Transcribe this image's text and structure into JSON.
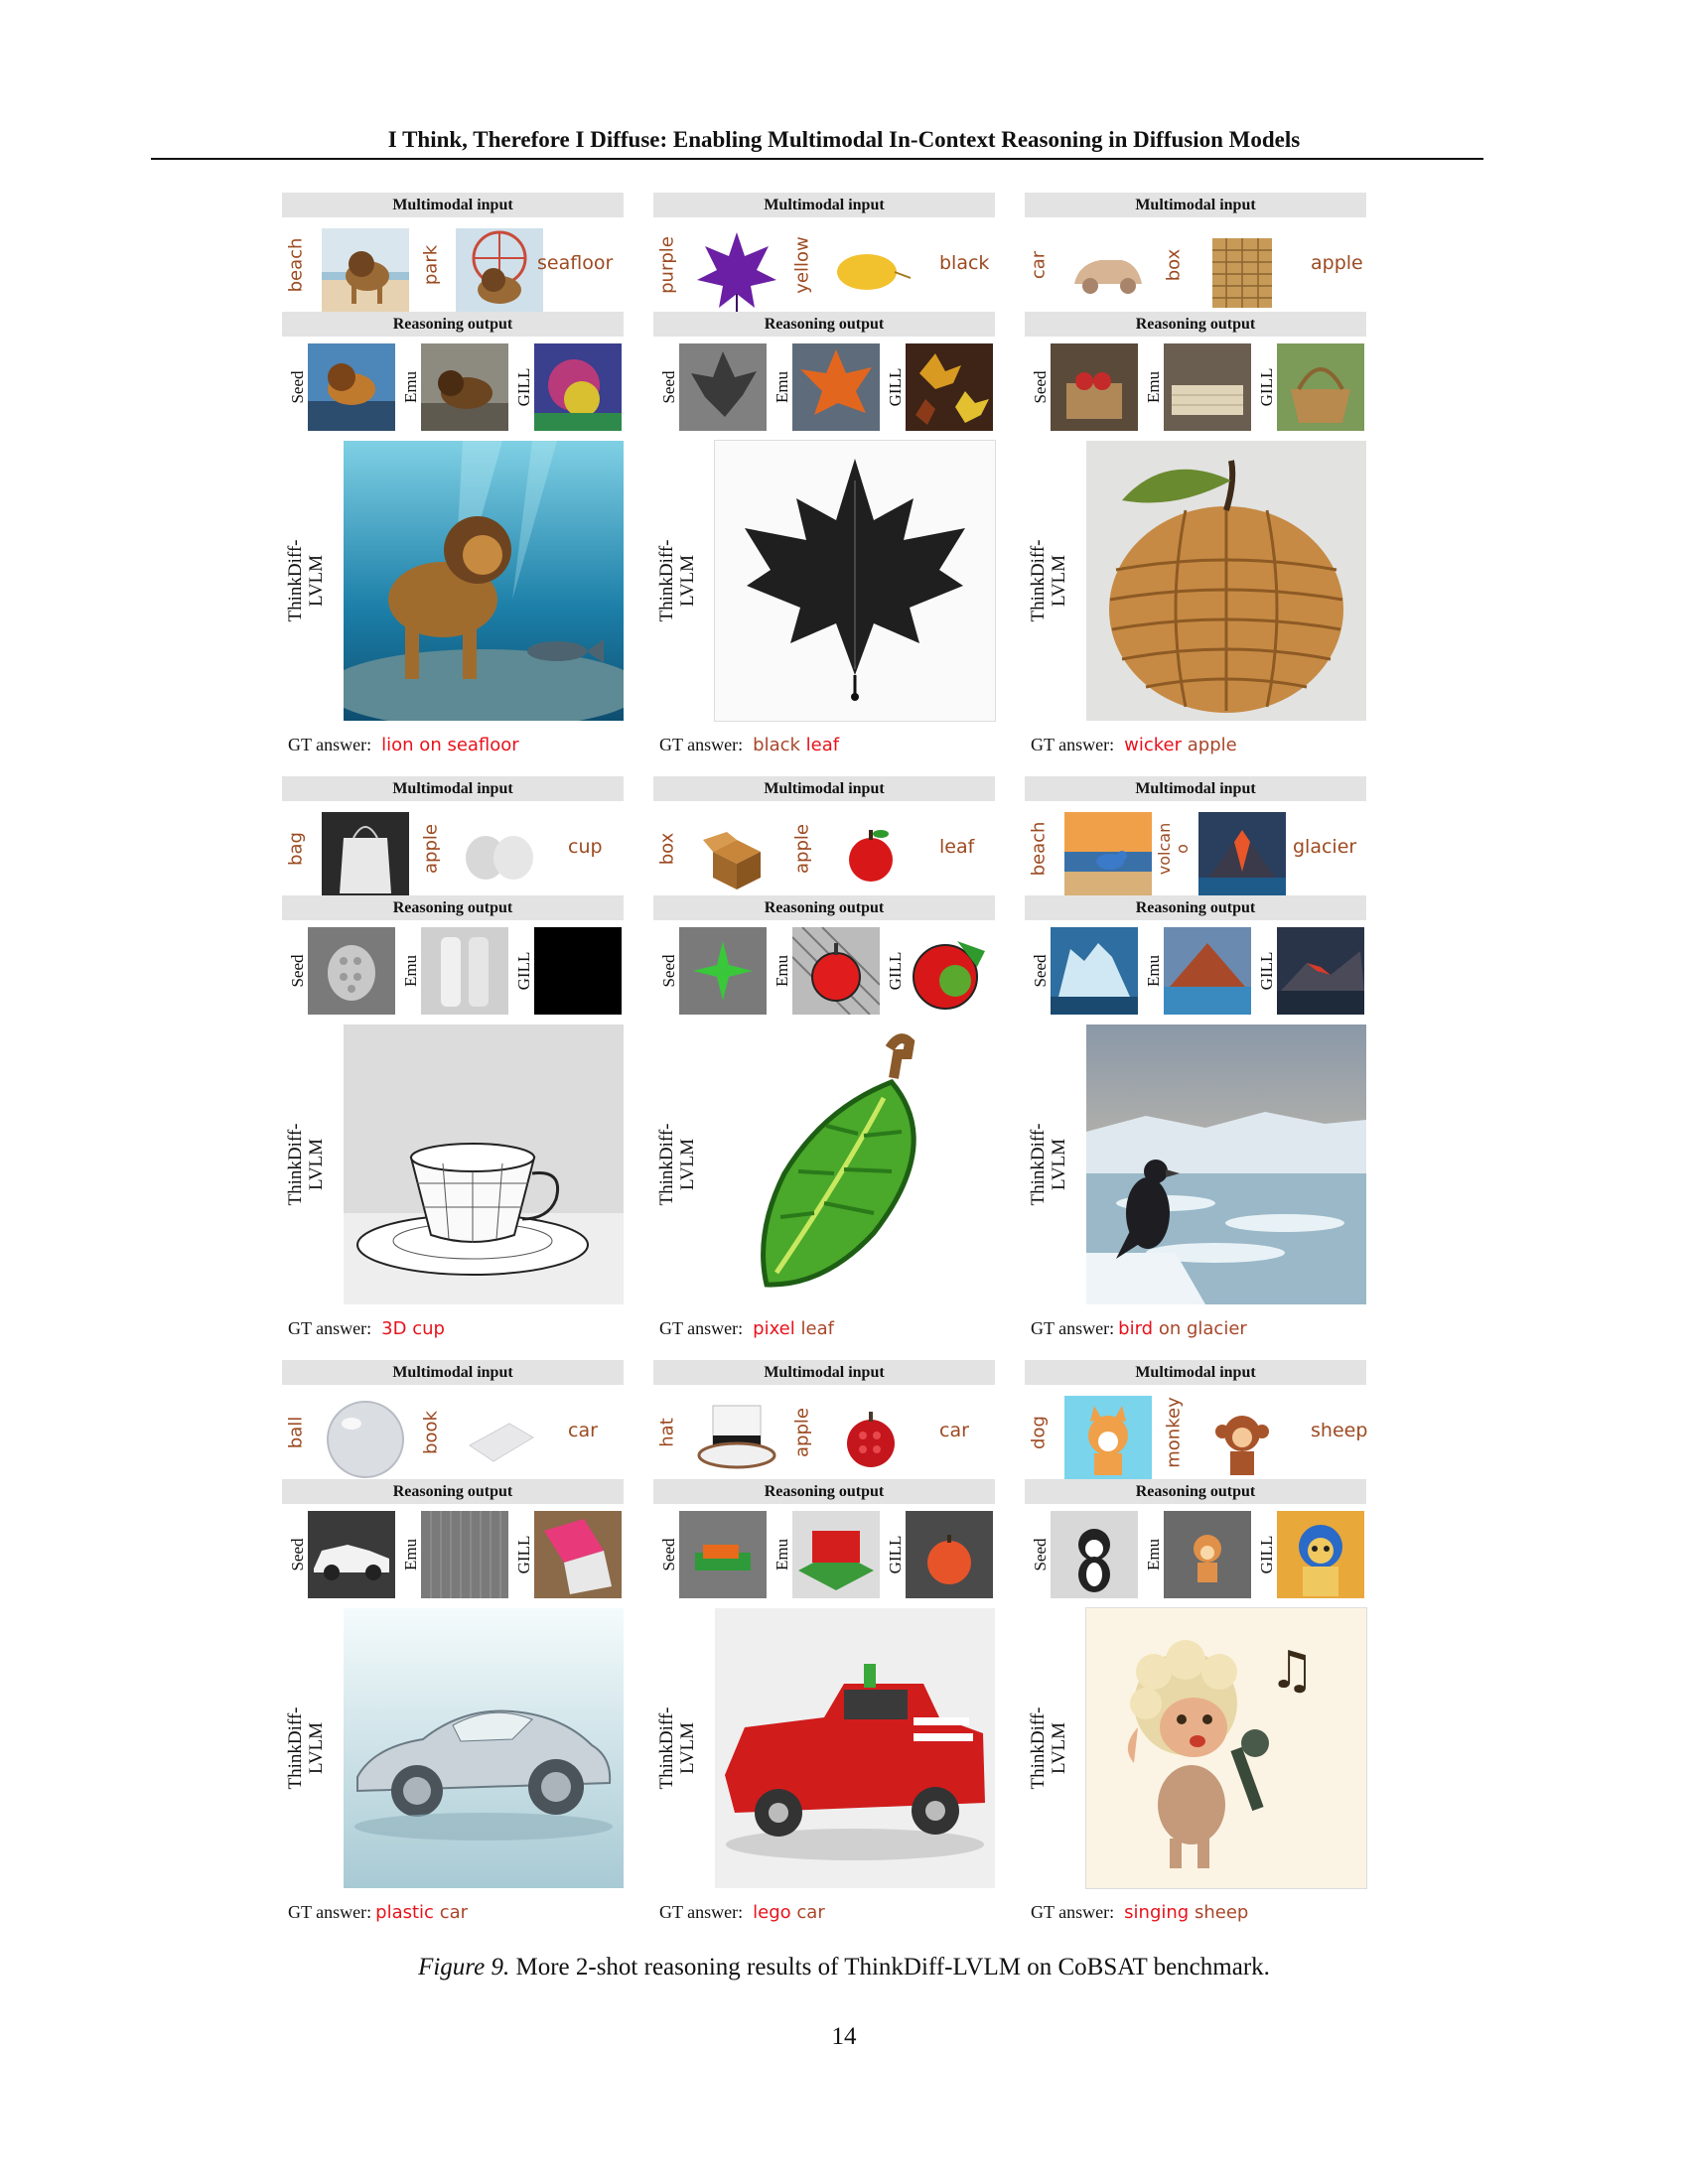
{
  "paper_title": "I Think, Therefore I Diffuse: Enabling Multimodal In-Context Reasoning in Diffusion Models",
  "section_labels": {
    "input": "Multimodal input",
    "output": "Reasoning output"
  },
  "models": [
    "Seed",
    "Emu",
    "GILL"
  ],
  "main_model_line1": "ThinkDiff-",
  "main_model_line2": "LVLM",
  "gt_prefix": "GT answer:",
  "panels": [
    {
      "label_a": "beach",
      "label_b": "park",
      "label_c": "seafloor",
      "ans_key": "lion on seafloor",
      "ans_rest": ""
    },
    {
      "label_a": "purple",
      "label_b": "yellow",
      "label_c": "black",
      "ans_key": "black",
      "ans_rest": "leaf",
      "key_color": "#a8462a",
      "rest_color": "#e8121b"
    },
    {
      "label_a": "car",
      "label_b": "box",
      "label_c": "apple",
      "ans_key": "wicker",
      "ans_rest": "apple"
    },
    {
      "label_a": "bag",
      "label_b": "apple",
      "label_c": "cup",
      "ans_key": "3D cup",
      "ans_rest": ""
    },
    {
      "label_a": "box",
      "label_b": "apple",
      "label_c": "leaf",
      "ans_key": "pixel",
      "ans_rest": "leaf"
    },
    {
      "label_a": "beach",
      "label_b": "volcan\no",
      "label_c": "glacier",
      "ans_key": "bird",
      "ans_rest": "on glacier"
    },
    {
      "label_a": "ball",
      "label_b": "book",
      "label_c": "car",
      "ans_key": "plastic",
      "ans_rest": "car"
    },
    {
      "label_a": "hat",
      "label_b": "apple",
      "label_c": "car",
      "ans_key": "lego",
      "ans_rest": "car"
    },
    {
      "label_a": "dog",
      "label_b": "monkey",
      "label_c": "sheep",
      "ans_key": "singing",
      "ans_rest": "sheep"
    }
  ],
  "caption_label": "Figure 9.",
  "caption_text": "More 2-shot reasoning results of ThinkDiff-LVLM on CoBSAT benchmark.",
  "page_number": "14"
}
